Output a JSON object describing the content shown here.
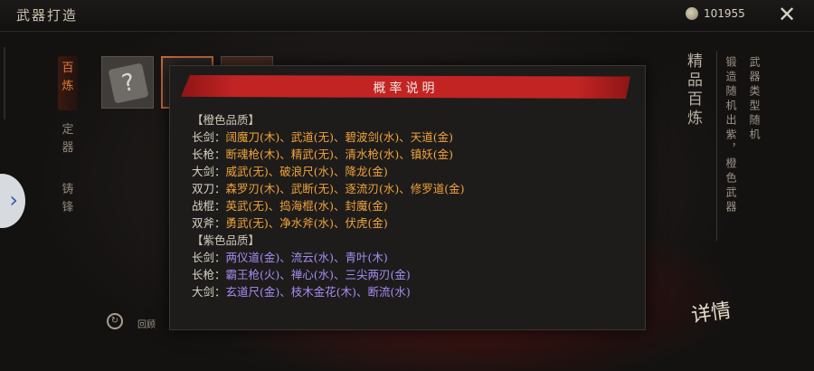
{
  "header": {
    "title": "武器打造",
    "currency_value": "101955"
  },
  "left_tabs": [
    "百炼",
    "定器",
    "铸锋"
  ],
  "slots": [
    "scroll-question",
    "selected-weapon",
    "weapon"
  ],
  "replay_label": "回顾",
  "right_panel": {
    "big": "精品百炼",
    "col1": "锻造随机出紫，橙色武器",
    "col2": "武器类型随机",
    "detail": "详情"
  },
  "popup": {
    "title": "概率说明",
    "sections": [
      {
        "heading": "【橙色品质】",
        "rows": [
          {
            "label": "长剑：",
            "items": "阔魔刀(木)、武道(无)、碧波剑(水)、天道(金)"
          },
          {
            "label": "长枪：",
            "items": "断魂枪(木)、精武(无)、清水枪(水)、镇妖(金)"
          },
          {
            "label": "大剑：",
            "items": "威武(无)、破浪尺(水)、降龙(金)"
          },
          {
            "label": "双刀：",
            "items": "森罗刃(木)、武断(无)、逐流刃(水)、修罗道(金)"
          },
          {
            "label": "战棍：",
            "items": "英武(无)、捣海棍(水)、封魔(金)"
          },
          {
            "label": "双斧：",
            "items": "勇武(无)、净水斧(水)、伏虎(金)"
          }
        ]
      },
      {
        "heading": "【紫色品质】",
        "rows": [
          {
            "label": "长剑：",
            "items": "两仪道(金)、流云(水)、青叶(木)"
          },
          {
            "label": "长枪：",
            "items": "霸王枪(火)、禅心(水)、三尖两刃(金)"
          },
          {
            "label": "大剑：",
            "items": "玄道尺(金)、枝木金花(木)、断流(水)"
          }
        ]
      }
    ]
  },
  "colors": {
    "orange": "#f0a23a",
    "purple": "#a78bf2",
    "header_red": "#c22424",
    "tab_active": "#e07a3c"
  }
}
